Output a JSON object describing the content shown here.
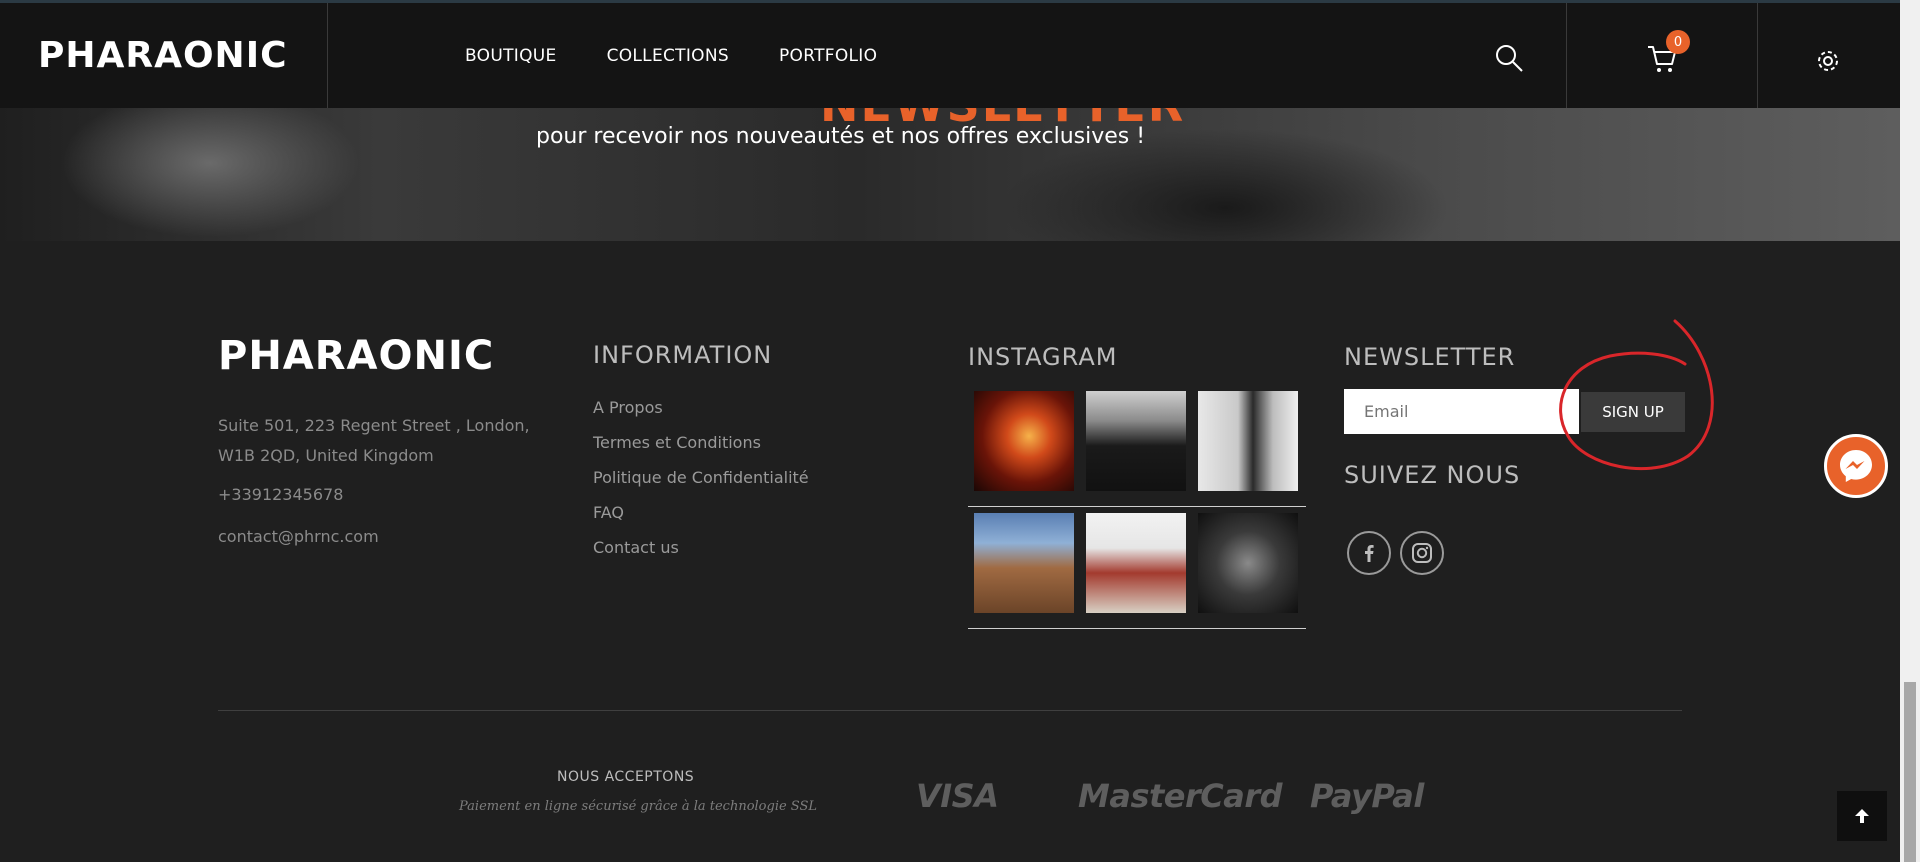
{
  "header": {
    "logo": "PHARAONIC",
    "nav": [
      "BOUTIQUE",
      "COLLECTIONS",
      "PORTFOLIO"
    ],
    "cart_count": "0",
    "icons": [
      "search-icon",
      "cart-icon",
      "gear-icon"
    ]
  },
  "hero": {
    "title": "NEWSLETTER",
    "subtitle": "pour recevoir nos nouveautés et nos offres exclusives !"
  },
  "footer": {
    "logo": "PHARAONIC",
    "address": "Suite 501, 223 Regent Street , London, W1B 2QD, United Kingdom",
    "phone": "+33912345678",
    "email": "contact@phrnc.com",
    "information": {
      "title": "INFORMATION",
      "links": [
        "A Propos",
        "Termes et Conditions",
        "Politique de Confidentialité",
        "FAQ",
        "Contact us"
      ]
    },
    "instagram": {
      "title": "INSTAGRAM"
    },
    "newsletter": {
      "title": "NEWSLETTER",
      "placeholder": "Email",
      "button": "SIGN UP"
    },
    "follow": {
      "title": "SUIVEZ NOUS",
      "icons": [
        "facebook-icon",
        "instagram-icon"
      ]
    },
    "payment": {
      "title": "NOUS ACCEPTONS",
      "subtitle": "Paiement en ligne sécurisé grâce à la technologie SSL",
      "brands": [
        "VISA",
        "MasterCard",
        "PayPal"
      ]
    }
  },
  "colors": {
    "accent": "#e8622a",
    "header_bg": "#141414",
    "footer_bg": "#1f1f1f",
    "annotation": "#d9262a"
  }
}
